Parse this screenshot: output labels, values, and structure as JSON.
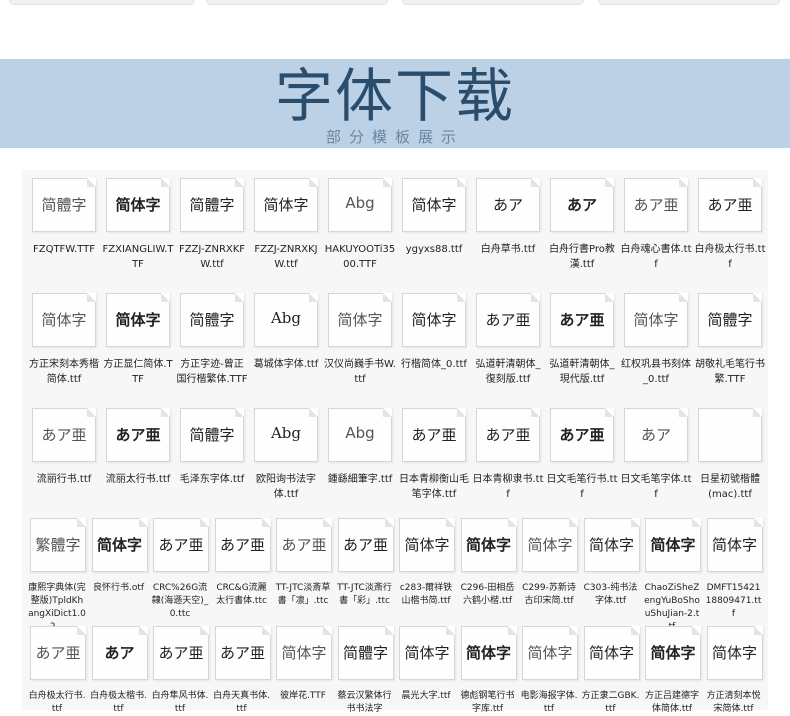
{
  "banner": {
    "title": "字体下载",
    "subtitle": "部分模板展示"
  },
  "rows": [
    [
      {
        "glyph": "简體字",
        "name": "FZQTFW.TTF"
      },
      {
        "glyph": "简体字",
        "name": "FZXIANGLIW.TTF"
      },
      {
        "glyph": "简體字",
        "name": "FZZJ-ZNRXKFW.ttf"
      },
      {
        "glyph": "简体字",
        "name": "FZZJ-ZNRXKJW.ttf"
      },
      {
        "glyph": "Abg",
        "name": "HAKUYOOTi3500.TTF"
      },
      {
        "glyph": "简体字",
        "name": "ygyxs88.ttf"
      },
      {
        "glyph": "あア",
        "name": "白舟草书.ttf"
      },
      {
        "glyph": "あア",
        "name": "白舟行書Pro教漢.ttf"
      },
      {
        "glyph": "あア亜",
        "name": "白舟魂心書体.ttf"
      },
      {
        "glyph": "あア亜",
        "name": "白舟极太行书.ttf"
      }
    ],
    [
      {
        "glyph": "简体字",
        "name": "方正宋刻本秀楷简体.ttf"
      },
      {
        "glyph": "简体字",
        "name": "方正显仁简体.TTF"
      },
      {
        "glyph": "简體字",
        "name": "方正字迹-曾正国行楷繁体.TTF"
      },
      {
        "glyph": "Abg",
        "name": "葛城体字体.ttf"
      },
      {
        "glyph": "简体字",
        "name": "汉仪尚巍手书W.ttf"
      },
      {
        "glyph": "简体字",
        "name": "行楷简体_0.ttf"
      },
      {
        "glyph": "あア亜",
        "name": "弘道軒清朝体_復刻版.ttf"
      },
      {
        "glyph": "あア亜",
        "name": "弘道軒清朝体_現代版.ttf"
      },
      {
        "glyph": "简体字",
        "name": "红权巩县书刻体_0.ttf"
      },
      {
        "glyph": "简體字",
        "name": "胡敬礼毛笔行书繁.TTF"
      }
    ],
    [
      {
        "glyph": "あア亜",
        "name": "流丽行书.ttf"
      },
      {
        "glyph": "あア亜",
        "name": "流丽太行书.ttf"
      },
      {
        "glyph": "简體字",
        "name": "毛泽东字体.ttf"
      },
      {
        "glyph": "Abg",
        "name": "欧阳询书法字体.ttf"
      },
      {
        "glyph": "Abg",
        "name": "鍾繇細筆字.ttf"
      },
      {
        "glyph": "あア亜",
        "name": "日本青柳衡山毛笔字体.ttf"
      },
      {
        "glyph": "あア亜",
        "name": "日本青柳隶书.ttf"
      },
      {
        "glyph": "あア亜",
        "name": "日文毛笔行书.ttf"
      },
      {
        "glyph": "あア",
        "name": "日文毛笔字体.ttf"
      },
      {
        "glyph": "",
        "name": "日星初號楷體(mac).ttf"
      }
    ],
    [
      {
        "glyph": "繁體字",
        "name": "康熙字典体(完整版)TpldKhangXiDict1.02..."
      },
      {
        "glyph": "简体字",
        "name": "良怀行书.otf"
      },
      {
        "glyph": "あア亜",
        "name": "CRC%26G流隸(海遜天空)_0.ttc"
      },
      {
        "glyph": "あア亜",
        "name": "CRC&G流麗太行書体.ttc"
      },
      {
        "glyph": "あア亜",
        "name": "TT-JTC淡斎草書「凛」.ttc"
      },
      {
        "glyph": "あア亜",
        "name": "TT-JTC淡斎行書「彩」.ttc"
      },
      {
        "glyph": "简体字",
        "name": "c283-爾祥铁山楷书简.ttf"
      },
      {
        "glyph": "简体字",
        "name": "C296-田相岳六鹤小楷.ttf"
      },
      {
        "glyph": "简体字",
        "name": "C299-苏新诗古印宋简.ttf"
      },
      {
        "glyph": "简体字",
        "name": "C303-纯书法字体.ttf"
      },
      {
        "glyph": "简体字",
        "name": "ChaoZiSheZengYuBoShouShuJian-2.ttf"
      },
      {
        "glyph": "简体字",
        "name": "DMFT1542118809471.ttf"
      }
    ],
    [
      {
        "glyph": "あア亜",
        "name": "白舟极太行书.ttf"
      },
      {
        "glyph": "あア",
        "name": "白舟极太楷书.ttf"
      },
      {
        "glyph": "あア亜",
        "name": "白舟隼风书体.ttf"
      },
      {
        "glyph": "あア亜",
        "name": "白舟天真书体.ttf"
      },
      {
        "glyph": "简体字",
        "name": "彼岸花.TTF"
      },
      {
        "glyph": "简體字",
        "name": "蔡云汉繁体行书书法字"
      },
      {
        "glyph": "简体字",
        "name": "晨光大字.ttf"
      },
      {
        "glyph": "简体字",
        "name": "德彪钢笔行书字库.ttf"
      },
      {
        "glyph": "简体字",
        "name": "电影海报字体.ttf"
      },
      {
        "glyph": "简体字",
        "name": "方正隶二GBK.ttf"
      },
      {
        "glyph": "简体字",
        "name": "方正吕建德字体简体.ttf"
      },
      {
        "glyph": "简体字",
        "name": "方正清刻本悦宋简体.ttf"
      }
    ]
  ]
}
